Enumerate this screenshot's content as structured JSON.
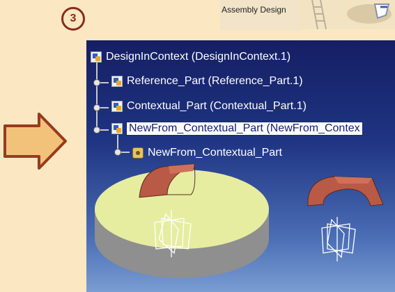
{
  "step": {
    "number": "3"
  },
  "workbench": {
    "label": "Assembly Design",
    "icon": "assembly-design-icon"
  },
  "tree": {
    "root": {
      "label": "DesignInContext (DesignInContext.1)",
      "icon": "product-icon"
    },
    "children": [
      {
        "label": "Reference_Part (Reference_Part.1)",
        "icon": "part-icon",
        "selected": false
      },
      {
        "label": "Contextual_Part (Contextual_Part.1)",
        "icon": "part-icon",
        "selected": false
      },
      {
        "label": "NewFrom_Contextual_Part (NewFrom_Contex",
        "icon": "part-icon",
        "selected": true
      }
    ],
    "subchild": {
      "label": "NewFrom_Contextual_Part",
      "icon": "gear-part-icon"
    }
  },
  "colors": {
    "arrow_fill": "#f2c27a",
    "arrow_stroke": "#9a3a1e",
    "selection_bg": "#ffffff",
    "viewer_top": "#151f63",
    "viewer_bottom": "#7a9dd3",
    "disc_top": "#e6eda0",
    "disc_side": "#8f8f8f",
    "shell": "#b85a45"
  }
}
